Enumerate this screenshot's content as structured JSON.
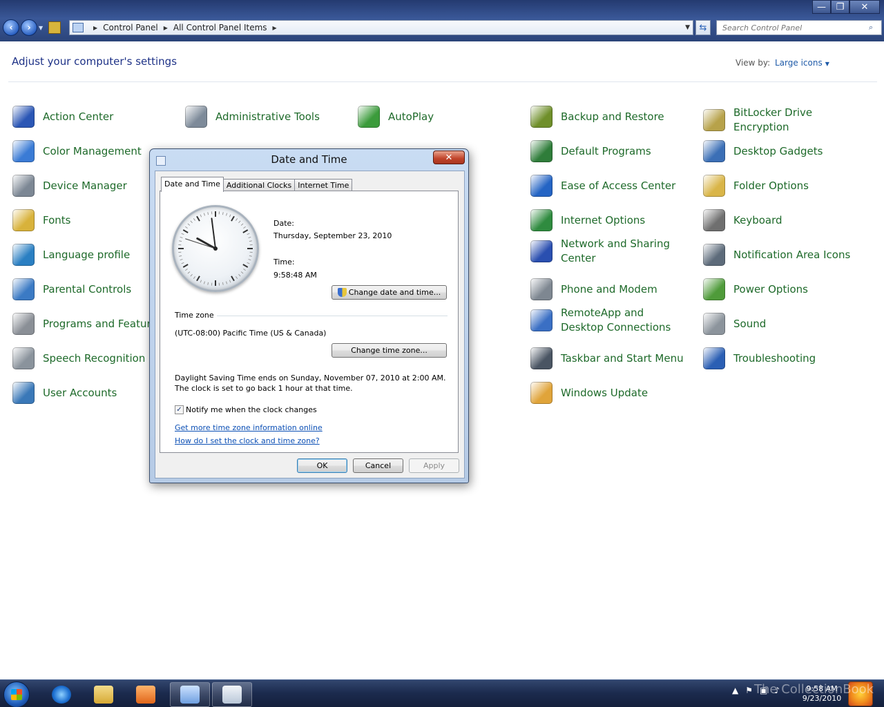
{
  "window": {
    "minimize": "—",
    "maximize": "❐",
    "close": "✕"
  },
  "nav": {
    "back_icon": "arrow-left-icon",
    "forward_icon": "arrow-right-icon",
    "breadcrumbs": [
      "Control Panel",
      "All Control Panel Items"
    ]
  },
  "search": {
    "placeholder": "Search Control Panel"
  },
  "header": {
    "title": "Adjust your computer's settings",
    "view_by_label": "View by:",
    "view_by_value": "Large icons"
  },
  "items": [
    {
      "label": "Action Center",
      "color": "#2a56b5"
    },
    {
      "label": "Administrative Tools",
      "color": "#7d8a99"
    },
    {
      "label": "AutoPlay",
      "color": "#3b9b3b"
    },
    {
      "label": "Backup and Restore",
      "color": "#6f8f2a"
    },
    {
      "label": "BitLocker Drive Encryption",
      "color": "#b7a24a"
    },
    {
      "label": "Color Management",
      "color": "#3a7bd5"
    },
    {
      "label": "Default Programs",
      "color": "#2f7d3a"
    },
    {
      "label": "Desktop Gadgets",
      "color": "#3b6fb6"
    },
    {
      "label": "Device Manager",
      "color": "#7c8794"
    },
    {
      "label": "Ease of Access Center",
      "color": "#2464c4"
    },
    {
      "label": "Folder Options",
      "color": "#d9b548"
    },
    {
      "label": "Fonts",
      "color": "#d8b23b"
    },
    {
      "label": "Internet Options",
      "color": "#2f8b3f"
    },
    {
      "label": "Keyboard",
      "color": "#6f6f6f"
    },
    {
      "label": "Language profile",
      "color": "#2a7fc2"
    },
    {
      "label": "Network and Sharing Center",
      "color": "#2a4fb0"
    },
    {
      "label": "Notification Area Icons",
      "color": "#5d6b7a"
    },
    {
      "label": "Parental Controls",
      "color": "#3b7ac4"
    },
    {
      "label": "Phone and Modem",
      "color": "#7e8791"
    },
    {
      "label": "Power Options",
      "color": "#4f9b3a"
    },
    {
      "label": "Programs and Features",
      "color": "#8a8f96"
    },
    {
      "label": "RemoteApp and Desktop Connections",
      "color": "#3a6fc4"
    },
    {
      "label": "Sound",
      "color": "#8c949c"
    },
    {
      "label": "Speech Recognition",
      "color": "#8a939c"
    },
    {
      "label": "Taskbar and Start Menu",
      "color": "#4a5563"
    },
    {
      "label": "Troubleshooting",
      "color": "#2b5fb4"
    },
    {
      "label": "User Accounts",
      "color": "#3a78b8"
    },
    {
      "label": "Windows Update",
      "color": "#e0a43a"
    }
  ],
  "dialog": {
    "title": "Date and Time",
    "close_label": "✕",
    "tabs": [
      "Date and Time",
      "Additional Clocks",
      "Internet Time"
    ],
    "date_label": "Date:",
    "date_value": "Thursday, September 23, 2010",
    "time_label": "Time:",
    "time_value": "9:58:48 AM",
    "change_datetime_button": "Change date and time...",
    "timezone_group": "Time zone",
    "timezone_value": "(UTC-08:00) Pacific Time (US & Canada)",
    "change_timezone_button": "Change time zone...",
    "dst_text": "Daylight Saving Time ends on Sunday, November 07, 2010 at 2:00 AM. The clock is set to go back 1 hour at that time.",
    "notify_checkbox_label": "Notify me when the clock changes",
    "notify_checked": true,
    "link_more_info": "Get more time zone information online",
    "link_how": "How do I set the clock and time zone?",
    "ok_button": "OK",
    "cancel_button": "Cancel",
    "apply_button": "Apply",
    "clock": {
      "hours": 9,
      "minutes": 58,
      "seconds": 48
    }
  },
  "taskbar": {
    "time": "9:58 AM",
    "date": "9/23/2010",
    "watermark": "The CollectionBook"
  }
}
